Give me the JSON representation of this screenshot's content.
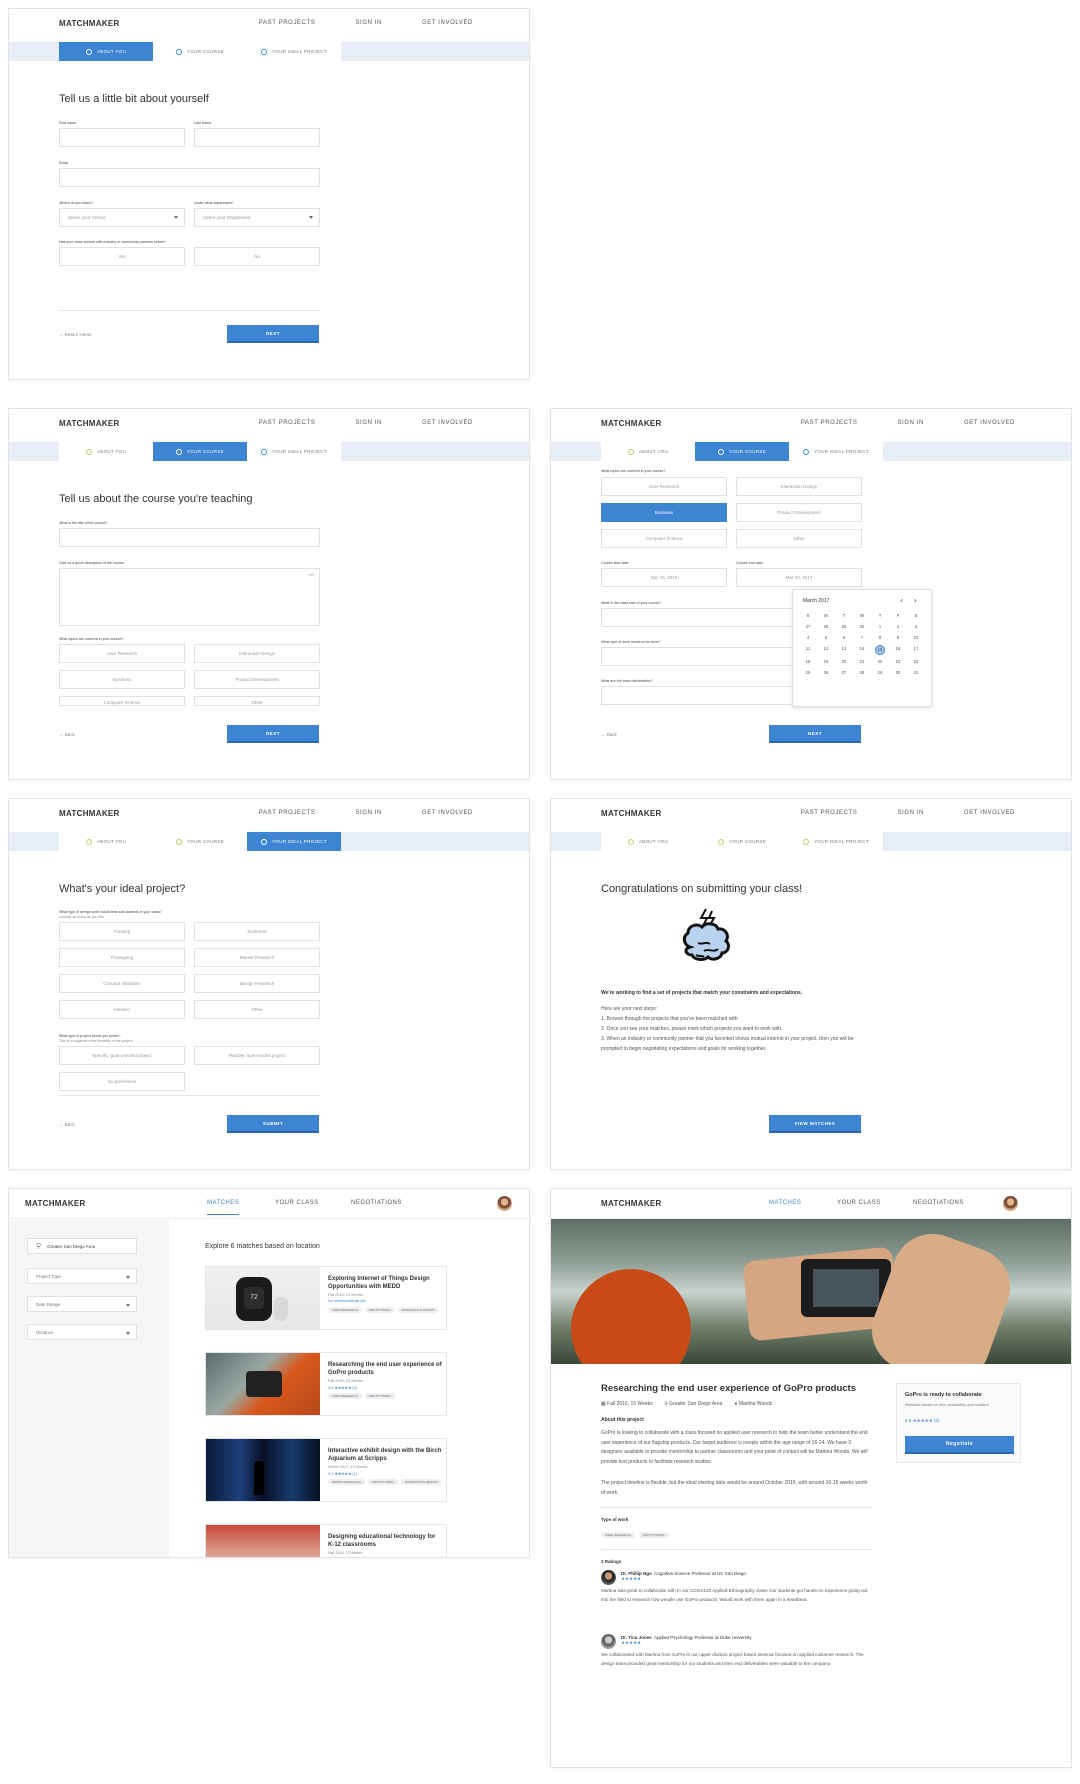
{
  "brand": "MATCHMAKER",
  "nav_links": [
    "PAST PROJECTS",
    "SIGN IN",
    "GET INVOLVED"
  ],
  "steps": [
    "ABOUT YOU",
    "YOUR COURSE",
    "YOUR IDEAL PROJECT"
  ],
  "colors": {
    "accent": "#3d84d2",
    "done": "#b6d06b",
    "stepbar": "#e7eef7"
  },
  "p1": {
    "title": "Tell us a little bit about yourself",
    "first_name": "First name",
    "last_name": "Last Name",
    "email": "Email",
    "school_q": "Where do you teach?",
    "dept_q": "Under what department?",
    "school_ph": "Select your School",
    "dept_ph": "Select your Department",
    "worked_q": "Has your class worked with industry or community partners before?",
    "yes": "Yes",
    "no": "No",
    "return": "Return Home",
    "next": "NEXT"
  },
  "p2": {
    "title": "Tell us about the course you're teaching",
    "course_q": "What is the title of the course?",
    "desc_q": "Give us a quick description of the course",
    "counter": "0/0",
    "topics_q": "What topics are covered in your course?",
    "topics": [
      "User Research",
      "Interaction Design",
      "Business",
      "Product Development",
      "Computer Science",
      "Other"
    ],
    "back": "Back",
    "next": "NEXT"
  },
  "p3": {
    "topics_q": "What topics are covered in your course?",
    "topics": [
      "User Research",
      "Interaction Design",
      "Business",
      "Product Development",
      "Computer Science",
      "Other"
    ],
    "start_lbl": "Course start date",
    "end_lbl": "Course end date",
    "start": "Nov 15, 2016",
    "end": "Mar 15, 2017",
    "size_q": "What is the class size of your course?",
    "work_q": "What type of work needs to be done?",
    "deliv_q": "What are the team deliverables?",
    "back": "Back",
    "next": "NEXT",
    "cal_month": "March 2017",
    "cal_arrows": "‹ ›",
    "cal_days": [
      "S",
      "M",
      "T",
      "W",
      "T",
      "F",
      "S"
    ],
    "cal_dates": [
      "27",
      "28",
      "29",
      "30",
      "1",
      "2",
      "3",
      "4",
      "5",
      "6",
      "7",
      "8",
      "9",
      "10",
      "11",
      "12",
      "13",
      "14",
      "15",
      "16",
      "17",
      "18",
      "19",
      "20",
      "21",
      "22",
      "23",
      "24",
      "25",
      "26",
      "27",
      "28",
      "29",
      "30",
      "31"
    ],
    "cal_selected": "15"
  },
  "p4": {
    "title": "What's your ideal project?",
    "design_q": "What type of design work would best suit students in your class?",
    "design_sub": "Choose as many as you like",
    "design": [
      "Framing",
      "Synthesis",
      "Prototyping",
      "Market Research",
      "Concept Validation",
      "Design Research",
      "Ideation",
      "Other"
    ],
    "proj_q": "What type of project would you prefer?",
    "proj_sub": "This is in regards to the flexibility of the project",
    "proj": [
      "Specific, goal-oriented project",
      "Flexible, open-ended project",
      "No preference"
    ],
    "back": "Back",
    "submit": "SUBMIT"
  },
  "p5": {
    "title": "Congratulations on submitting your class!",
    "bold": "We're working to find a set of projects that match your constraints and expectations.",
    "steps_intro": "Here are your next steps:",
    "s1": "1.  Browse through the projects that you've been matched with",
    "s2": "2.  Once you see your matches, please mark which projects you want to work with.",
    "s3": "3.  When an industry or community partner that you favorited shows mutual interest in your project, then you will be prompted to begin negotiating expectations and goals for working together.",
    "view": "VIEW MATCHES"
  },
  "app_nav": [
    "MATCHES",
    "YOUR CLASS",
    "NEGOTIATIONS"
  ],
  "p6": {
    "search": "Greater San Diego Area",
    "filters": [
      "Project Type",
      "Date Range",
      "Distance"
    ],
    "heading": "Explore 6 matches based on location",
    "cards": [
      {
        "title": "Exploring Internet of Things Design Opportunities with MEDD",
        "meta": "Fall 2016, 19 Weeks",
        "meta2": "No reviews/ratings yet",
        "tags": [
          "USER RESEARCH",
          "PROTOTYPING",
          "INTERACTION DESIGN"
        ]
      },
      {
        "title": "Researching the end user experience of GoPro products",
        "meta": "Fall 2016, 15 Weeks",
        "meta2": "4.9 ★★★★★ (2)",
        "tags": [
          "USER RESEARCH",
          "PROTOTYPING"
        ]
      },
      {
        "title": "Interactive exhibit design with the Birch Aquarium at Scripps",
        "meta": "Winter 2017, 10 Weeks",
        "meta2": "4.3 ★★★★★ (1)",
        "tags": [
          "DESIGN RESEARCH",
          "PROTOTYPING",
          "INTERACTION DESIGN"
        ]
      },
      {
        "title": "Designing educational technology for K-12 classrooms",
        "meta": "Fall 2016, 12 Weeks",
        "meta2": "",
        "tags": []
      }
    ]
  },
  "p7": {
    "title": "Researching the end user experience of GoPro products",
    "term": "Fall 2016, 15 Weeks",
    "loc": "Greater San Diego Area",
    "person": "Martina Woods",
    "about_h": "About this project",
    "about1": "GoPro is looking to collaborate with a class focused on applied user research to help the team better understand the end user experience of our flagship products. Our target audience is people within the age range of 16-24. We have 3 designers available to provide mentorship to partner classrooms and your point of contact will be Martina Woods. We will provide test products to facilitate research studies.",
    "about2": "The project timeline is flexible, but the ideal starting date would be around October 2016, with around 10-15 weeks worth of work.",
    "type_h": "Type of work",
    "tags": [
      "USER RESEARCH",
      "PROTOTYPING"
    ],
    "ratings_h": "2 Ratings",
    "r1_name": "Dr. Phillip Ngo",
    "r1_role": "Cognitive Science Professor at UC San Diego",
    "r1_text": "Martina was great to collaborate with in our COGS120 Applied Ethnography class! Our students got hands-on experience going out into the field to research how people use GoPro products. Would work with them again in a heartbeat.",
    "r2_name": "Dr. Tina Jones",
    "r2_role": "Applied Psychology Professor at Duke University",
    "r2_text": "We collaborated with Martina from GoPro in our upper division project based seminar focused on applied customer research. The design team provided great mentorship for our students and then end deliverables were valuable to the company.",
    "stars": "★★★★★",
    "side_title": "GoPro is ready to collaborate",
    "side_sub": "Matched based on time availability and location",
    "side_rating": "4.9 ★★★★★ (2)",
    "negotiate": "Negotiate"
  }
}
